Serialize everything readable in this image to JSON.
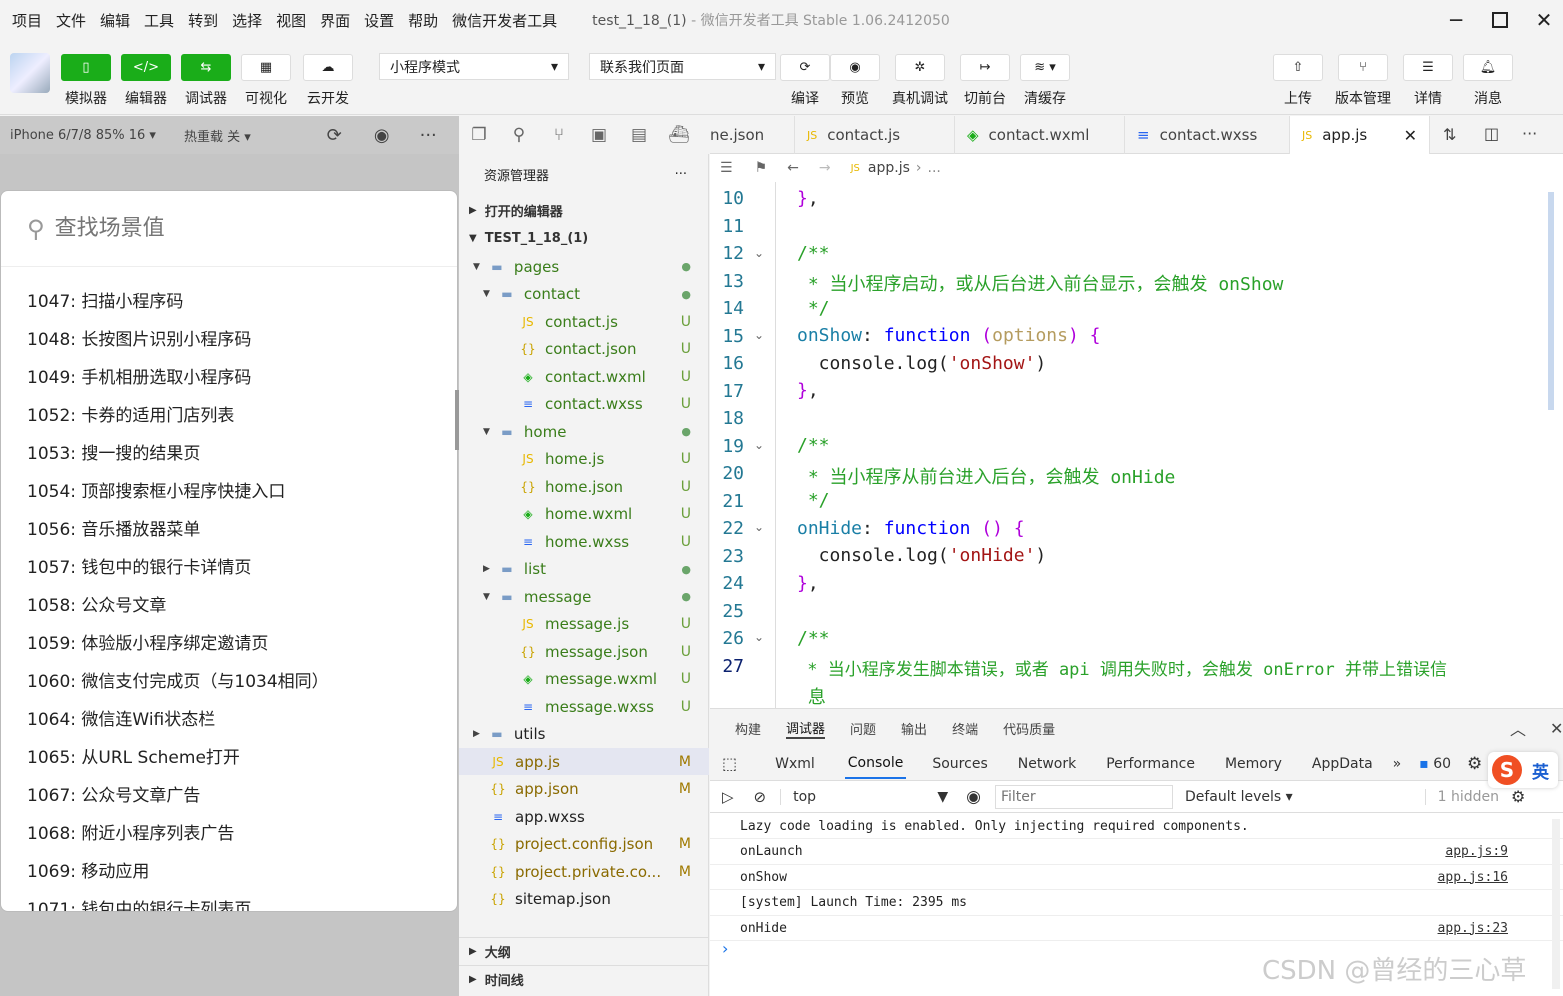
{
  "menubar": {
    "items": [
      "项目",
      "文件",
      "编辑",
      "工具",
      "转到",
      "选择",
      "视图",
      "界面",
      "设置",
      "帮助",
      "微信开发者工具"
    ],
    "project": "test_1_18_(1)",
    "app_title": "- 微信开发者工具 Stable 1.06.2412050"
  },
  "toolbar": {
    "simulator": "模拟器",
    "editor": "编辑器",
    "debugger": "调试器",
    "visual": "可视化",
    "cloud": "云开发",
    "mode": "小程序模式",
    "page": "联系我们页面",
    "compile": "编译",
    "preview": "预览",
    "real_debug": "真机调试",
    "background": "切前台",
    "clear_cache": "清缓存",
    "upload": "上传",
    "version": "版本管理",
    "details": "详情",
    "messages": "消息"
  },
  "simulator": {
    "device": "iPhone 6/7/8 85% 16",
    "hot_reload": "热重载 关",
    "search_placeholder": "查找场景值",
    "scenes": [
      "1047: 扫描小程序码",
      "1048: 长按图片识别小程序码",
      "1049: 手机相册选取小程序码",
      "1052: 卡券的适用门店列表",
      "1053: 搜一搜的结果页",
      "1054: 顶部搜索框小程序快捷入口",
      "1056: 音乐播放器菜单",
      "1057: 钱包中的银行卡详情页",
      "1058: 公众号文章",
      "1059: 体验版小程序绑定邀请页",
      "1060: 微信支付完成页（与1034相同）",
      "1064: 微信连Wifi状态栏",
      "1065: 从URL Scheme打开",
      "1067: 公众号文章广告",
      "1068: 附近小程序列表广告",
      "1069: 移动应用",
      "1071: 钱包中的银行卡列表页"
    ]
  },
  "explorer": {
    "title": "资源管理器",
    "open_editors": "打开的编辑器",
    "project": "TEST_1_18_(1)",
    "rows": [
      {
        "name": "pages",
        "icon": "folder-icon",
        "status": "●"
      },
      {
        "name": "contact",
        "icon": "folder-icon",
        "status": "●"
      },
      {
        "name": "contact.js",
        "icon": "js-file-icon",
        "status": "U"
      },
      {
        "name": "contact.json",
        "icon": "json-file-icon",
        "status": "U"
      },
      {
        "name": "contact.wxml",
        "icon": "wxml-file-icon",
        "status": "U"
      },
      {
        "name": "contact.wxss",
        "icon": "wxss-file-icon",
        "status": "U"
      },
      {
        "name": "home",
        "icon": "folder-icon",
        "status": "●"
      },
      {
        "name": "home.js",
        "icon": "js-file-icon",
        "status": "U"
      },
      {
        "name": "home.json",
        "icon": "json-file-icon",
        "status": "U"
      },
      {
        "name": "home.wxml",
        "icon": "wxml-file-icon",
        "status": "U"
      },
      {
        "name": "home.wxss",
        "icon": "wxss-file-icon",
        "status": "U"
      },
      {
        "name": "list",
        "icon": "folder-icon",
        "status": "●"
      },
      {
        "name": "message",
        "icon": "folder-icon",
        "status": "●"
      },
      {
        "name": "message.js",
        "icon": "js-file-icon",
        "status": "U"
      },
      {
        "name": "message.json",
        "icon": "json-file-icon",
        "status": "U"
      },
      {
        "name": "message.wxml",
        "icon": "wxml-file-icon",
        "status": "U"
      },
      {
        "name": "message.wxss",
        "icon": "wxss-file-icon",
        "status": "U"
      },
      {
        "name": "utils",
        "icon": "folder-icon",
        "status": ""
      },
      {
        "name": "app.js",
        "icon": "js-file-icon",
        "status": "M"
      },
      {
        "name": "app.json",
        "icon": "json-file-icon",
        "status": "M"
      },
      {
        "name": "app.wxss",
        "icon": "wxss-file-icon",
        "status": ""
      },
      {
        "name": "project.config.json",
        "icon": "json-file-icon",
        "status": "M"
      },
      {
        "name": "project.private.co...",
        "icon": "json-file-icon",
        "status": "M"
      },
      {
        "name": "sitemap.json",
        "icon": "json-file-icon",
        "status": ""
      }
    ],
    "outline": "大纲",
    "timeline": "时间线"
  },
  "tabs": [
    "ne.json",
    "contact.js",
    "contact.wxml",
    "contact.wxss",
    "app.js"
  ],
  "breadcrumb": {
    "file": "app.js",
    "more": "..."
  },
  "editor": {
    "line_numbers": [
      "10",
      "11",
      "12",
      "13",
      "14",
      "15",
      "16",
      "17",
      "18",
      "19",
      "20",
      "21",
      "22",
      "23",
      "24",
      "25",
      "26",
      "27"
    ],
    "comment_onshow": " * 当小程序启动，或从后台进入前台显示，会触发 onShow",
    "comment_onhide": " * 当小程序从前台进入后台，会触发 onHide",
    "comment_onerror": " * 当小程序发生脚本错误，或者 api 调用失败时，会触发 onError 并带上错误信",
    "comment_onerror_wrap": "息",
    "log_onshow": "'onShow'",
    "log_onhide": "'onHide'"
  },
  "panel": {
    "tabs": [
      "构建",
      "调试器",
      "问题",
      "输出",
      "终端",
      "代码质量"
    ],
    "devtools_tabs": [
      "Wxml",
      "Console",
      "Sources",
      "Network",
      "Performance",
      "Memory",
      "AppData"
    ],
    "message_count": "60",
    "context": "top",
    "filter_placeholder": "Filter",
    "levels": "Default levels",
    "hidden": "1 hidden",
    "logs": [
      {
        "msg": "Lazy code loading is enabled. Only injecting required components.",
        "src": ""
      },
      {
        "msg": "onLaunch",
        "src": "app.js:9"
      },
      {
        "msg": "onShow",
        "src": "app.js:16"
      },
      {
        "msg": "[system] Launch Time: 2395 ms",
        "src": ""
      },
      {
        "msg": "onHide",
        "src": "app.js:23"
      }
    ],
    "prompt": "›"
  },
  "ime": {
    "label": "英"
  },
  "watermark": "CSDN @曾经的三心草"
}
